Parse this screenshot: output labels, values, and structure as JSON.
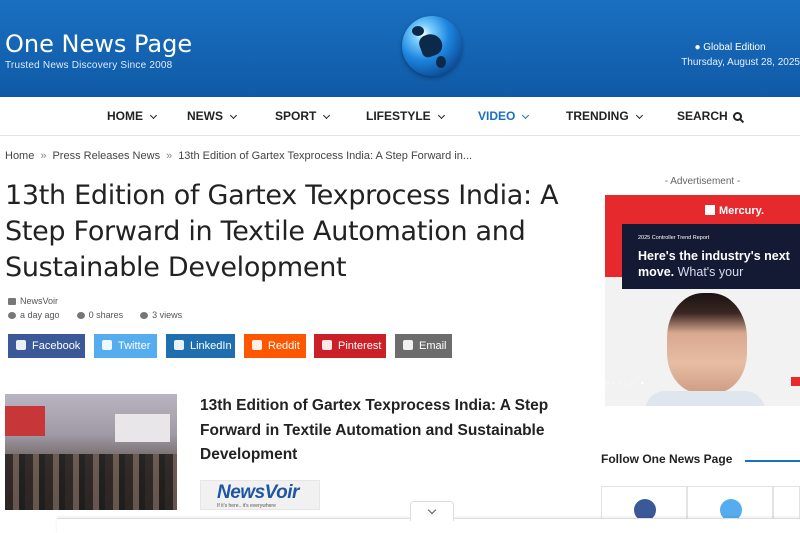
{
  "header": {
    "site_title": "One News Page",
    "tagline": "Trusted News Discovery Since 2008",
    "edition": "Global Edition",
    "date": "Thursday, August 28, 2025"
  },
  "nav": {
    "items": [
      {
        "label": "HOME"
      },
      {
        "label": "NEWS"
      },
      {
        "label": "SPORT"
      },
      {
        "label": "LIFESTYLE"
      },
      {
        "label": "VIDEO"
      },
      {
        "label": "TRENDING"
      }
    ],
    "search_label": "SEARCH",
    "active": "VIDEO"
  },
  "breadcrumb": {
    "home": "Home",
    "section": "Press Releases News",
    "current": "13th Edition of Gartex Texprocess India: A Step Forward in...",
    "separator": "»"
  },
  "article": {
    "title": "13th Edition of Gartex Texprocess India: A Step Forward in Textile Automation and Sustainable Development",
    "source": "NewsVoir",
    "time": "a day ago",
    "shares": "0 shares",
    "views": "3 views"
  },
  "share_buttons": [
    {
      "label": "Facebook",
      "color": "#3b5998"
    },
    {
      "label": "Twitter",
      "color": "#55acee"
    },
    {
      "label": "LinkedIn",
      "color": "#1f6fb0"
    },
    {
      "label": "Reddit",
      "color": "#ff5700"
    },
    {
      "label": "Pinterest",
      "color": "#cb2027"
    },
    {
      "label": "Email",
      "color": "#6c6c6c"
    }
  ],
  "card": {
    "title": "13th Edition of Gartex Texprocess India: A Step Forward in Textile Automation and Sustainable Development",
    "logo_text": "NewsVoir",
    "logo_tagline": "If it's here.. it's everywhere"
  },
  "sidebar": {
    "ad_label": "- Advertisement -",
    "ad": {
      "brand": "Mercury.",
      "report": "2025 Controller Trend Report",
      "headline_bold": "Here's the industry's next move.",
      "headline_thin": "What's your"
    },
    "follow_title": "Follow One News Page"
  },
  "colors": {
    "header_blue": "#1a6fc1",
    "accent_blue": "#1a6fc1",
    "ad_red": "#e5292c"
  }
}
